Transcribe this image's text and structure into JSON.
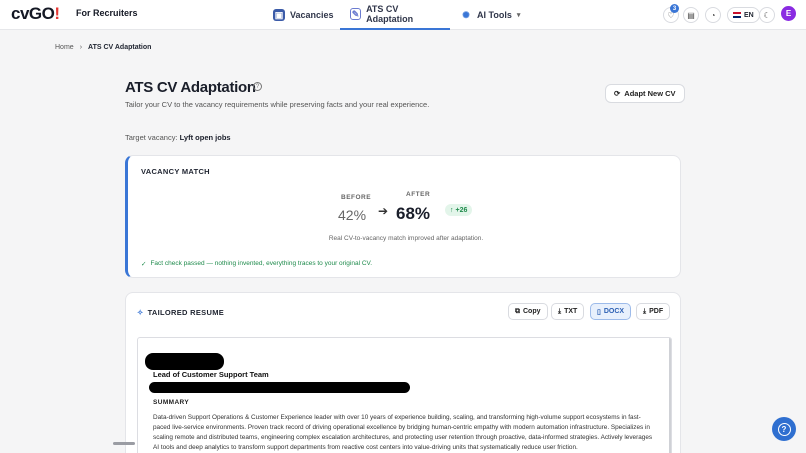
{
  "header": {
    "logo_main": "cvGO",
    "logo_bang": "!",
    "for_recruiters": "For Recruiters",
    "nav": [
      {
        "label": "Vacancies",
        "icon": "briefcase-icon"
      },
      {
        "label": "ATS CV Adaptation",
        "icon": "document-magic-icon"
      },
      {
        "label": "AI Tools",
        "icon": "sparkle-icon"
      }
    ],
    "favorites_badge": "3",
    "language": "EN",
    "avatar_initial": "E"
  },
  "breadcrumb": {
    "home": "Home",
    "current": "ATS CV Adaptation"
  },
  "page": {
    "title": "ATS CV Adaptation",
    "subtitle": "Tailor your CV to the vacancy requirements while preserving facts and your real experience.",
    "adapt_button": "Adapt New CV",
    "target_label": "Target vacancy:",
    "target_value": "Lyft open jobs"
  },
  "match": {
    "title": "VACANCY MATCH",
    "before_label": "BEFORE",
    "before_value": "42%",
    "after_label": "AFTER",
    "after_value": "68%",
    "delta": "+26",
    "note": "Real CV-to-vacancy match improved after adaptation.",
    "fact_check": "Fact check passed — nothing invented, everything traces to your original CV."
  },
  "resume": {
    "title": "TAILORED RESUME",
    "actions": {
      "copy": "Copy",
      "txt": "TXT",
      "docx": "DOCX",
      "pdf": "PDF"
    },
    "selected_format": "DOCX",
    "job_title": "Lead of Customer Support Team",
    "summary_heading": "SUMMARY",
    "summary_text": "Data-driven Support Operations & Customer Experience leader with over 10 years of experience building, scaling, and transforming high-volume support ecosystems in fast-paced live-service environments. Proven track record of driving operational excellence by bridging human-centric empathy with modern automation infrastructure. Specializes in scaling remote and distributed teams, engineering complex escalation architectures, and protecting user retention through proactive, data-informed strategies. Actively leverages AI tools and deep analytics to transform support departments from reactive cost centers into value-driving units that systematically reduce user friction."
  },
  "colors": {
    "accent": "#3a76d6",
    "success": "#1f8b4c",
    "avatar": "#8a2be2"
  }
}
